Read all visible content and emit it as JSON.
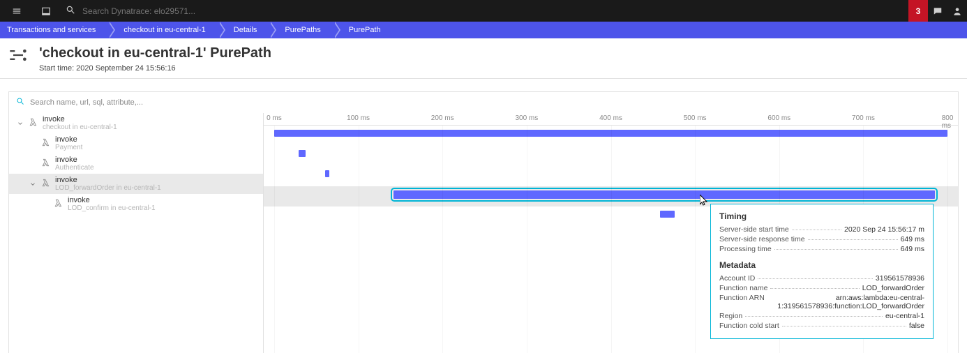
{
  "topbar": {
    "search_placeholder": "Search Dynatrace: elo29571...",
    "notif_count": "3"
  },
  "breadcrumbs": [
    "Transactions and services",
    "checkout in eu-central-1",
    "Details",
    "PurePaths",
    "PurePath"
  ],
  "page": {
    "title": "'checkout in eu-central-1' PurePath",
    "subtitle": "Start time: 2020 September 24 15:56:16"
  },
  "panel_search_placeholder": "Search name, url, sql, attribute,...",
  "axis_ticks": [
    "0 ms",
    "100 ms",
    "200 ms",
    "300 ms",
    "400 ms",
    "500 ms",
    "600 ms",
    "700 ms",
    "800 ms"
  ],
  "max_ms": 820,
  "nodes": [
    {
      "title": "invoke",
      "sub": "checkout in eu-central-1",
      "indent": 0,
      "expandable": true,
      "start": 0,
      "dur": 820,
      "selected": false
    },
    {
      "title": "invoke",
      "sub": "Payment",
      "indent": 1,
      "expandable": false,
      "start": 30,
      "dur": 8,
      "selected": false
    },
    {
      "title": "invoke",
      "sub": "Authenticate",
      "indent": 1,
      "expandable": false,
      "start": 62,
      "dur": 4,
      "selected": false
    },
    {
      "title": "invoke",
      "sub": "LOD_forwardOrder in eu-central-1",
      "indent": 1,
      "expandable": true,
      "start": 145,
      "dur": 660,
      "selected": true
    },
    {
      "title": "invoke",
      "sub": "LOD_confirm in eu-central-1",
      "indent": 2,
      "expandable": false,
      "start": 470,
      "dur": 18,
      "selected": false
    }
  ],
  "tooltip": {
    "timing_header": "Timing",
    "timing": [
      {
        "k": "Server-side start time",
        "v": "2020 Sep 24 15:56:17 m"
      },
      {
        "k": "Server-side response time",
        "v": "649 ms"
      },
      {
        "k": "Processing time",
        "v": "649 ms"
      }
    ],
    "metadata_header": "Metadata",
    "metadata": [
      {
        "k": "Account ID",
        "v": "319561578936"
      },
      {
        "k": "Function name",
        "v": "LOD_forwardOrder"
      },
      {
        "k": "Function ARN",
        "v": "arn:aws:lambda:eu-central-1:319561578936:function:LOD_forwardOrder"
      },
      {
        "k": "Region",
        "v": "eu-central-1"
      },
      {
        "k": "Function cold start",
        "v": "false"
      }
    ]
  }
}
